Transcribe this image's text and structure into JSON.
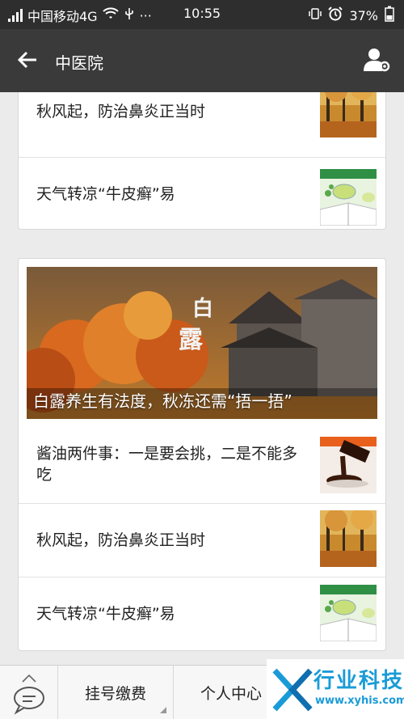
{
  "status": {
    "carrier": "中国移动4G",
    "time": "10:55",
    "battery": "37%"
  },
  "header": {
    "title": "中医院"
  },
  "card1": {
    "items": [
      {
        "title": "秋风起，防治鼻炎正当时",
        "thumb": "autumn-trees-thumbnail"
      },
      {
        "title": "天气转凉“牛皮癣”易",
        "thumb": "tea-book-thumbnail"
      }
    ]
  },
  "card2": {
    "banner": {
      "caption": "白露养生有法度，秋冻还需“捂一捂”",
      "art_text": "白露"
    },
    "items": [
      {
        "title": "酱油两件事：一是要会挑，二是不能多吃",
        "thumb": "soy-sauce-thumbnail"
      },
      {
        "title": "秋风起，防治鼻炎正当时",
        "thumb": "autumn-trees-thumbnail"
      },
      {
        "title": "天气转凉“牛皮癣”易",
        "thumb": "tea-book-thumbnail"
      }
    ]
  },
  "tabbar": {
    "tab1": "挂号缴费",
    "tab2": "个人中心"
  },
  "watermark": {
    "name": "行业科技",
    "url": "www.xyhis.com"
  }
}
